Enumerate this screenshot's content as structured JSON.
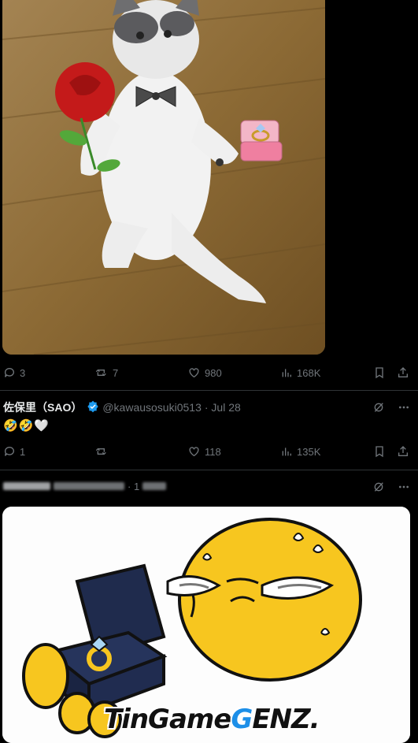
{
  "post1": {
    "stats": {
      "replies": "3",
      "reposts": "7",
      "likes": "980",
      "views": "168K"
    }
  },
  "reply": {
    "name": "佐保里（SAO）",
    "handle": "@kawausosuki0513",
    "time": "· Jul 28",
    "text": "🤣🤣🤍",
    "stats": {
      "replies": "1",
      "reposts": "",
      "likes": "118",
      "views": "135K"
    }
  },
  "post3": {
    "timestamp_visible": "· 1"
  },
  "watermark": {
    "part1": "TinGame",
    "accent": "G",
    "part2": "ENZ."
  },
  "colors": {
    "background": "#000000",
    "text": "#e7e9ea",
    "muted": "#71767b",
    "verified": "#1d9bf0"
  }
}
